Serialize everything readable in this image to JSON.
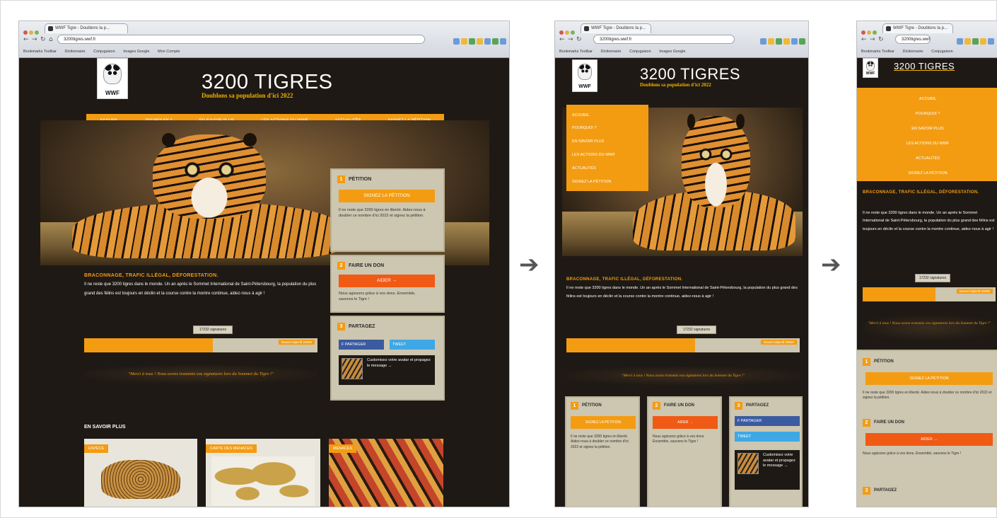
{
  "browser": {
    "tab_title": "WWF Tigre - Doublons la p...",
    "url": "3200tigres.wwf.fr",
    "bookmarks": [
      "Bookmarks Toolbar",
      "Dictionnaire",
      "Conjugaison",
      "Images Google",
      "Mon Compte"
    ]
  },
  "site": {
    "logo_text": "WWF",
    "title": "3200 TIGRES",
    "subtitle": "Doublons sa population d'ici 2022",
    "menu": [
      "Accueil",
      "Pourquoi ?",
      "En savoir plus",
      "Les actions du WWF",
      "Actualités",
      "Signez la pétition"
    ],
    "petition": {
      "num": "1",
      "heading": "Pétition",
      "button": "Signez la pétition",
      "text": "Il ne reste que 3200 tigres en liberté. Aidez-nous à doubler ce nombre d'ici 2022 et signez la pétition."
    },
    "don": {
      "num": "2",
      "heading": "Faire un don",
      "button": "Aider →",
      "text": "Nous agissons grâce à vos dons. Ensemble, sauvons le Tigre !"
    },
    "partage": {
      "num": "3",
      "heading": "Partagez",
      "facebook": "f Partager",
      "twitter": "Tweet",
      "box_text": "Customisez votre avatar et propagez le message →"
    },
    "poaching": {
      "heading": "Braconnage, trafic illégal, déforestation.",
      "text": "Il ne reste que 3200 tigres dans le monde. Un an après le Sommet International de Saint-Pétersbourg, la population du plus grand des félins est toujours en déclin et la course contre la montre continue, aidez-nous à agir !"
    },
    "signatures_label": "17232 signatures",
    "progress_label": "Nouvel objectif 20000",
    "progress_fraction": 0.55,
    "quote": "\"Merci à tous ! Nous avons transmis vos signatures lors du Sommet du Tigre !\"",
    "en_savoir_plus": "En savoir plus",
    "cards": [
      "Espèce",
      "Carte des menaces",
      "Menaces"
    ]
  },
  "colors": {
    "page_bg": "#1e1914",
    "accent_orange": "#f39c12",
    "donate_red": "#f05a14",
    "panel_beige": "#cdc6b0",
    "facebook_blue": "#3b5ba0",
    "twitter_blue": "#3ea8e6"
  },
  "icons": [
    "arrow-right-icon",
    "wwf-panda-logo",
    "tiger-photo"
  ]
}
